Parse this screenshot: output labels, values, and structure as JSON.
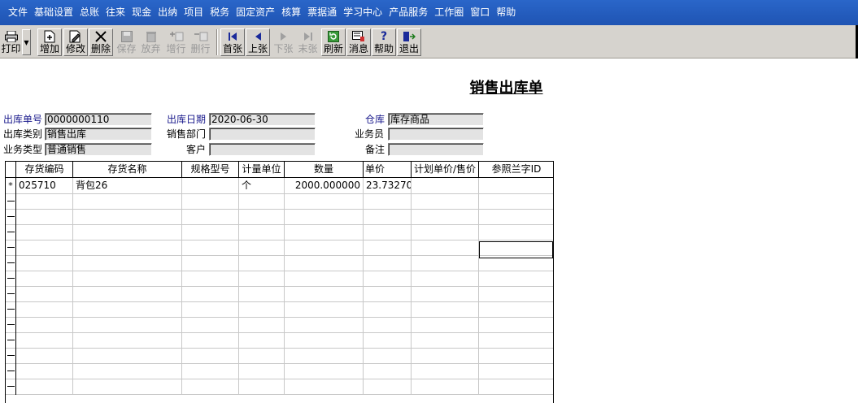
{
  "menu": [
    "文件",
    "基础设置",
    "总账",
    "往来",
    "现金",
    "出纳",
    "项目",
    "税务",
    "固定资产",
    "核算",
    "票据通",
    "学习中心",
    "产品服务",
    "工作圈",
    "窗口",
    "帮助"
  ],
  "toolbar": {
    "print": "打印",
    "add": "增加",
    "edit": "修改",
    "delete": "删除",
    "save": "保存",
    "discard": "放弃",
    "add_row": "增行",
    "delete_row": "删行",
    "first": "首张",
    "prev": "上张",
    "next": "下张",
    "last": "末张",
    "refresh": "刷新",
    "message": "消息",
    "help": "帮助",
    "exit": "退出"
  },
  "title": "销售出库单",
  "form": {
    "doc_no_label": "出库单号",
    "doc_no": "0000000110",
    "date_label": "出库日期",
    "date": "2020-06-30",
    "warehouse_label": "仓库",
    "warehouse": "库存商品",
    "out_type_label": "出库类别",
    "out_type": "销售出库",
    "dept_label": "销售部门",
    "dept": "",
    "salesman_label": "业务员",
    "salesman": "",
    "biz_type_label": "业务类型",
    "biz_type": "普通销售",
    "customer_label": "客户",
    "customer": "",
    "remark_label": "备注",
    "remark": ""
  },
  "grid": {
    "columns": [
      "存货编码",
      "存货名称",
      "规格型号",
      "计量单位",
      "数量",
      "单价",
      "计划单价/售价",
      "参照兰字ID"
    ],
    "rows": [
      {
        "marker": "*",
        "code": "025710",
        "name": "背包26",
        "spec": "",
        "unit": "个",
        "qty": "2000.000000",
        "price": "23.732700",
        "plan_price": "",
        "ref_id": ""
      }
    ]
  }
}
